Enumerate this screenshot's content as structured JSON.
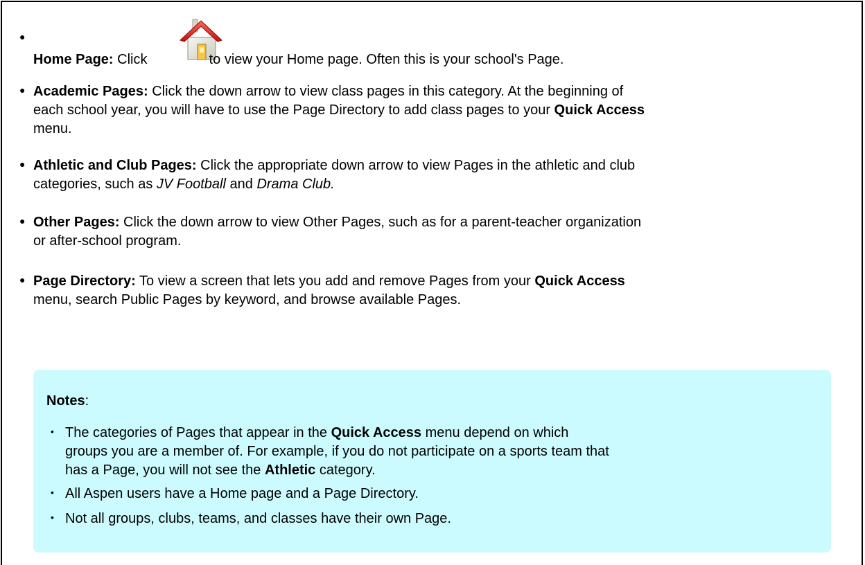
{
  "items": [
    {
      "label": "Home Page:",
      "text_before_icon": "Click",
      "icon": "home-icon",
      "text_after_icon": "to view your Home page. Often this is your school's Page."
    },
    {
      "label": "Academic Pages:",
      "text_1": "Click the down arrow to view class pages in this category. At the beginning of",
      "text_2": "each school year, you will have to use the Page Directory to add class pages to your",
      "bold_1": "Quick Access",
      "text_3": "menu."
    },
    {
      "label": "Athletic and Club Pages:",
      "text_1": "Click the appropriate down arrow to view Pages in the athletic and club",
      "text_2": "categories, such as",
      "italic_1": "JV Football",
      "text_3": "and",
      "italic_2": "Drama Club."
    },
    {
      "label": "Other Pages:",
      "text_1": "Click the down arrow to view Other Pages, such as for a parent-teacher organization",
      "text_2": "or after-school program."
    },
    {
      "label": "Page Directory:",
      "text_1": "To view a screen that lets you add and remove Pages from your",
      "bold_1": "Quick Access",
      "text_2": "menu, search Public Pages by keyword, and browse available Pages."
    }
  ],
  "notes": {
    "title": "Notes",
    "colon": ":",
    "bg_color": "#ccfbff",
    "items": [
      {
        "text_1": "The categories of Pages that appear in the",
        "bold_1": "Quick Access",
        "text_2": "menu depend on which",
        "text_3": "groups you are a member of. For example, if you do not participate on a sports team that",
        "text_4": "has a Page, you will not see the",
        "bold_2": "Athletic",
        "text_5": "category."
      },
      {
        "text_1": "All Aspen users have a Home page and a Page Directory."
      },
      {
        "text_1": "Not all groups, clubs, teams, and classes have their own Page."
      }
    ]
  }
}
